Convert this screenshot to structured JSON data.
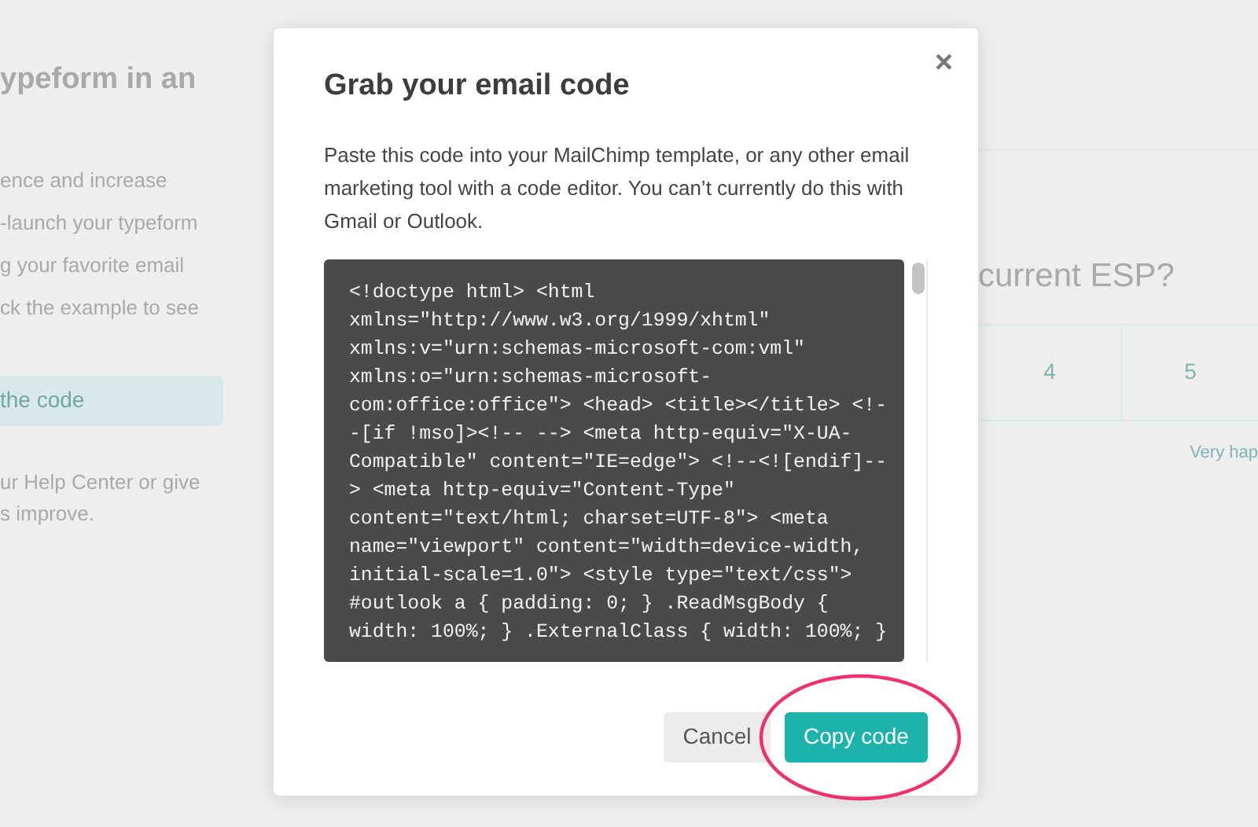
{
  "background": {
    "heading": "ypeform in an",
    "intro_lines": [
      "ence and increase",
      "-launch your typeform",
      "g your favorite email",
      "ck the example to see"
    ],
    "button": "the code",
    "help": {
      "before": "ur",
      "link1": "Help Center",
      "middle": "or",
      "link2": "give",
      "line2": "s improve."
    },
    "question": "current ESP?",
    "ratings": [
      {
        "label": "4"
      },
      {
        "label": "5"
      }
    ],
    "scale_label": "Very hap"
  },
  "modal": {
    "title": "Grab your email code",
    "close": "×",
    "description": "Paste this code into your MailChimp template, or any other email marketing tool with a code editor. You can’t currently do this with Gmail or Outlook.",
    "code_lines": [
      "<!doctype html> <html",
      "xmlns=\"http://www.w3.org/1999/xhtml\"",
      "xmlns:v=\"urn:schemas-microsoft-com:vml\"",
      "xmlns:o=\"urn:schemas-microsoft-",
      "com:office:office\"> <head> <title></title> <!-",
      "-[if !mso]><!-- --> <meta http-equiv=\"X-UA-",
      "Compatible\" content=\"IE=edge\"> <!--<![endif]--",
      "> <meta http-equiv=\"Content-Type\"",
      "content=\"text/html; charset=UTF-8\"> <meta",
      "name=\"viewport\" content=\"width=device-width,",
      "initial-scale=1.0\"> <style type=\"text/css\">",
      "#outlook a { padding: 0; } .ReadMsgBody {",
      "width: 100%; } .ExternalClass { width: 100%; }"
    ],
    "buttons": [
      {
        "kind": "secondary",
        "label": "Cancel",
        "highlighted": false
      },
      {
        "kind": "primary",
        "label": "Copy code",
        "highlighted": true
      }
    ]
  }
}
